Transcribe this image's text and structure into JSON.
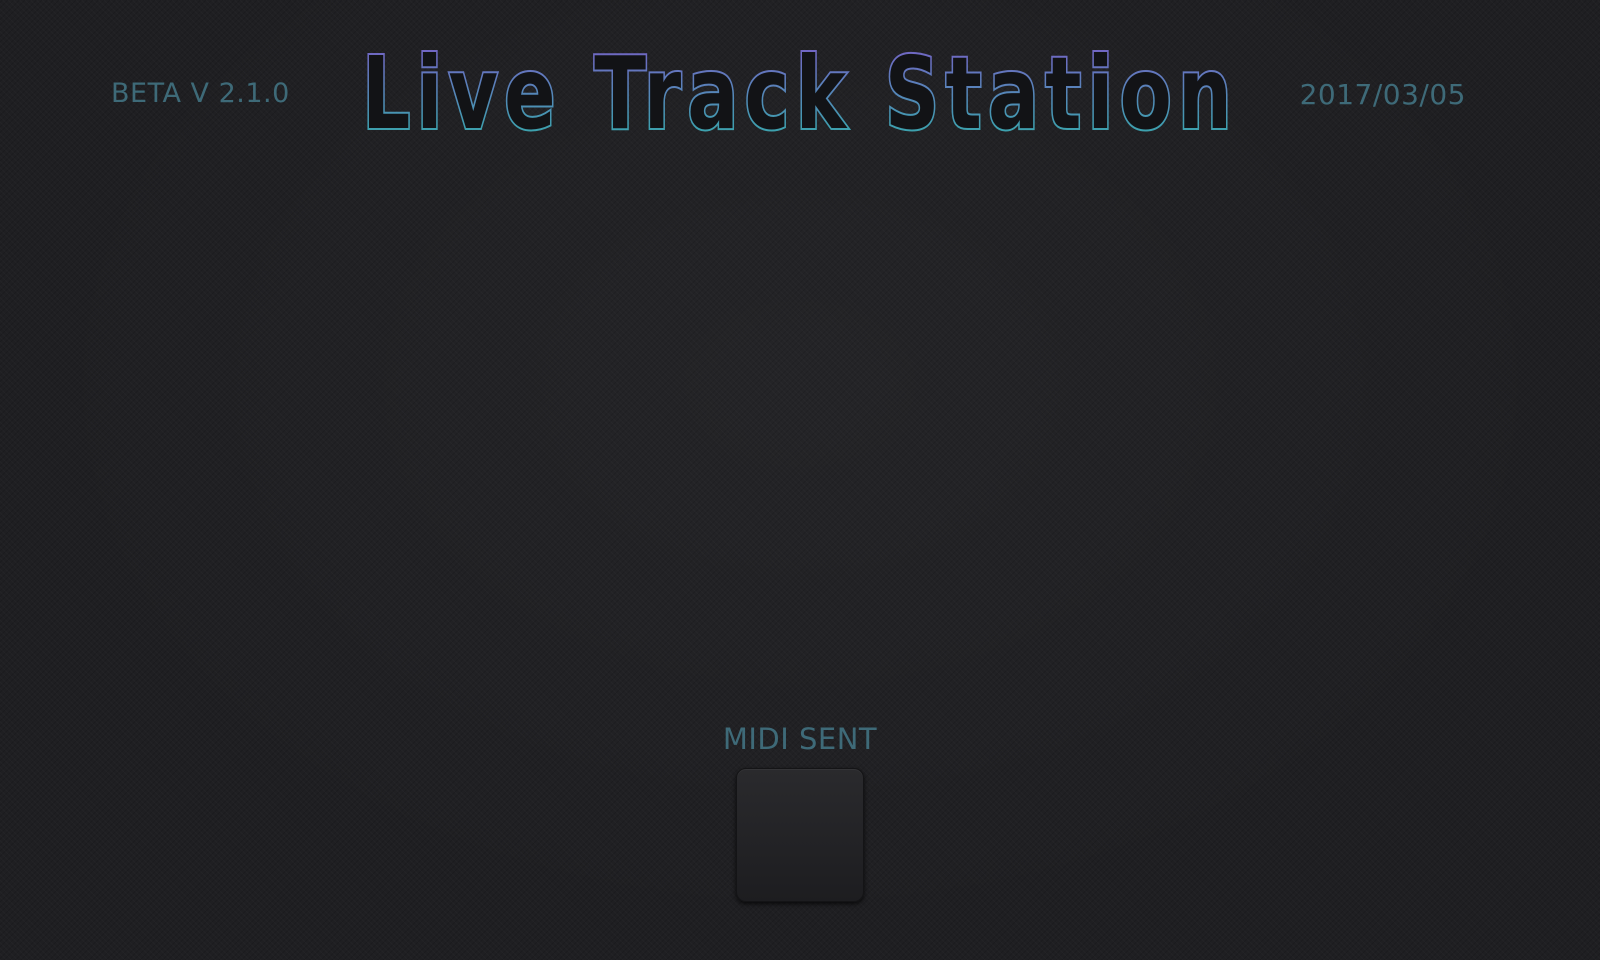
{
  "header": {
    "version": "BETA V 2.1.0",
    "title": "Live Track Station",
    "date": "2017/03/05"
  },
  "midi": {
    "label": "MIDI SENT",
    "active": false
  },
  "colors": {
    "background": "#1f1f22",
    "label_text": "#3e6a78",
    "title_gradient_top": "#7b5cc8",
    "title_gradient_bottom": "#2fb0a8",
    "indicator_off": "#252528"
  }
}
